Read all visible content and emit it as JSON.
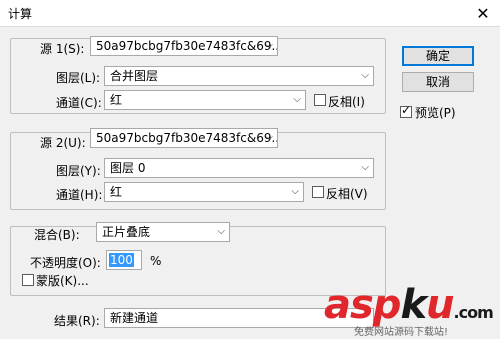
{
  "window": {
    "title": "计算",
    "close_glyph": "✕"
  },
  "source1": {
    "label": "源 1(S):",
    "file": "50a97bcbg7fb30e7483fc&69...",
    "layer_label": "图层(L):",
    "layer_value": "合并图层",
    "channel_label": "通道(C):",
    "channel_value": "红",
    "invert_label": "反相(I)",
    "invert_checked": false
  },
  "source2": {
    "label": "源 2(U):",
    "file": "50a97bcbg7fb30e7483fc&69...",
    "layer_label": "图层(Y):",
    "layer_value": "图层 0",
    "channel_label": "通道(H):",
    "channel_value": "红",
    "invert_label": "反相(V)",
    "invert_checked": false
  },
  "blend": {
    "label": "混合(B):",
    "value": "正片叠底",
    "opacity_label": "不透明度(O):",
    "opacity_value": "100",
    "opacity_unit": "%",
    "mask_label": "蒙版(K)...",
    "mask_checked": false
  },
  "result": {
    "label": "结果(R):",
    "value": "新建通道"
  },
  "buttons": {
    "ok": "确定",
    "cancel": "取消"
  },
  "preview": {
    "label": "预览(P)",
    "checked": true
  },
  "watermark": {
    "brand_red1": "asp",
    "brand_dark": "k",
    "brand_red2": "u",
    "domain": ".com",
    "tagline": "免费网站源码下载站!"
  },
  "icons": {
    "close": "close-icon",
    "dropdown": "chevron-down-icon"
  }
}
